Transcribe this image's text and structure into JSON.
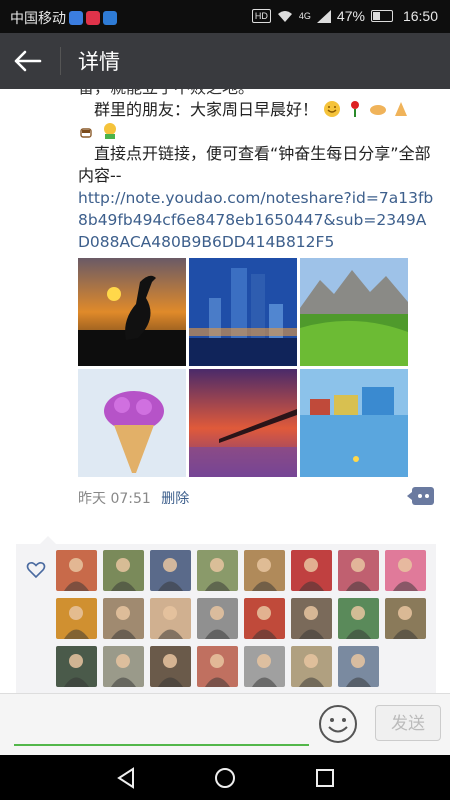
{
  "status_bar": {
    "carrier": "中国移动",
    "network": "4G",
    "battery": "47%",
    "battery_fraction": 0.47,
    "time": "16:50",
    "hd_label": "HD"
  },
  "header": {
    "title": "详情",
    "back_icon": "back-arrow-icon"
  },
  "post": {
    "partial_line": "留，就能立于不败之地。",
    "greeting": "群里的朋友：大家周日早晨好！",
    "intro": "直接点开链接，便可查看“钟奋生每日分享”全部内容--",
    "link": "http://note.youdao.com/noteshare?id=7a13fb8b49fb494cf6e8478eb1650447&sub=2349AD088ACA480B9B6DD414B812F5",
    "photos": [
      "sunset-crane",
      "city-skyline",
      "alpine-meadow",
      "flower-cone",
      "pier-sunset",
      "lake-houses"
    ],
    "time": "昨天 07:51",
    "delete_label": "删除"
  },
  "likes": {
    "icon": "heart-outline-icon",
    "avatar_count": 23
  },
  "input_bar": {
    "emoji_icon": "smiley-icon",
    "send_label": "发送",
    "accent_color": "#53b74a"
  },
  "nav": {
    "back": "nav-back-icon",
    "home": "nav-home-icon",
    "recents": "nav-recents-icon"
  }
}
